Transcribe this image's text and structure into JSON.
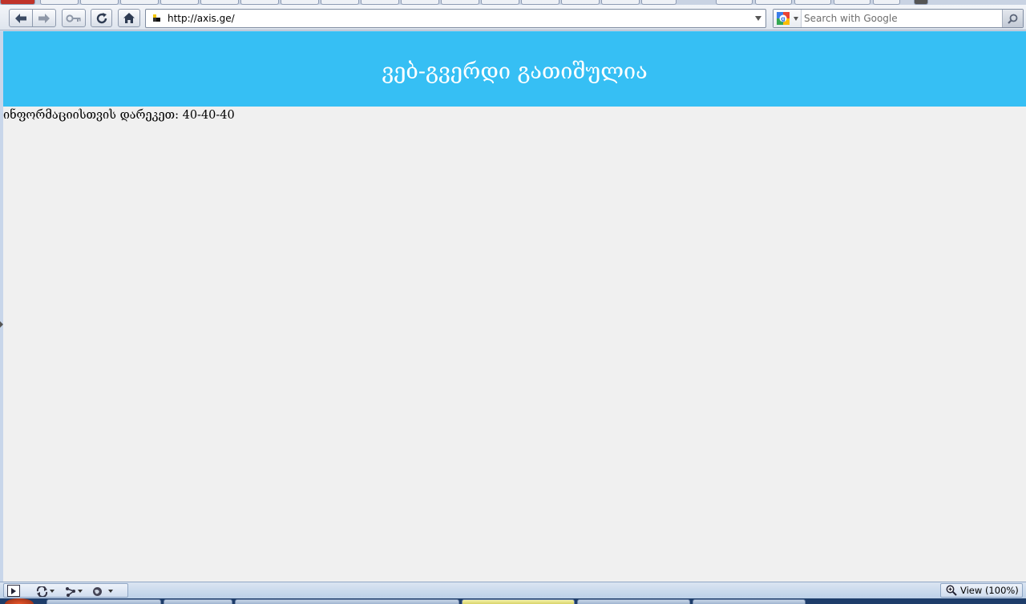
{
  "browser": {
    "url": "http://axis.ge/",
    "search_placeholder": "Search with Google",
    "zoom_label": "View (100%)"
  },
  "page": {
    "banner_title": "ვებ-გვერდი გათიშულია",
    "info_text": "ინფორმაციისთვის დარეკეთ: 40-40-40"
  },
  "colors": {
    "banner_bg": "#36bff4",
    "content_bg": "#f0f0f0",
    "banner_text": "#ffffff"
  },
  "icons": {
    "back": "arrow-left-icon",
    "forward": "arrow-right-icon",
    "identity": "key-icon",
    "reload": "reload-icon",
    "home": "home-icon",
    "search_engine": "google-icon",
    "search_go": "magnifier-icon",
    "zoom": "zoom-magnifier-icon"
  }
}
